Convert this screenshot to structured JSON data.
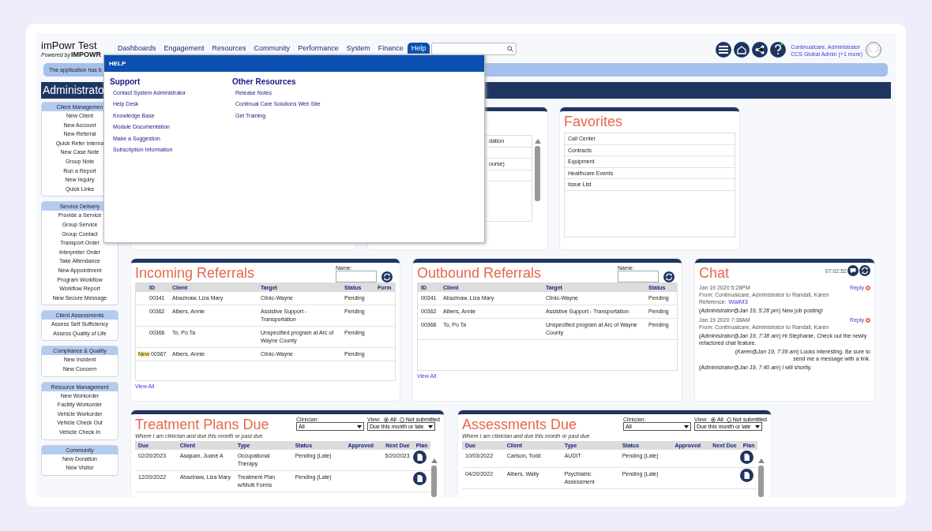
{
  "app": {
    "title": "imPowr Test",
    "powered_by": "Powered by",
    "brand": "IMPOWR"
  },
  "nav": [
    {
      "label": "Dashboards",
      "selected": false
    },
    {
      "label": "Engagement",
      "selected": false
    },
    {
      "label": "Resources",
      "selected": false
    },
    {
      "label": "Community",
      "selected": false
    },
    {
      "label": "Performance",
      "selected": false
    },
    {
      "label": "System",
      "selected": false
    },
    {
      "label": "Finance",
      "selected": false
    },
    {
      "label": "Help",
      "selected": true
    }
  ],
  "user": {
    "name": "Continualcare, Administrator",
    "role": "CCS Global Admin (+1 more)"
  },
  "banner": "The application has b",
  "page_title": "Administrato",
  "help_menu": {
    "title": "HELP",
    "sections": [
      {
        "heading": "Support",
        "links": [
          "Contact System Administrator",
          "Help Desk",
          "Knowledge Base",
          "Module Documentation",
          "Make a Suggestion",
          "Subscription Information"
        ]
      },
      {
        "heading": "Other Resources",
        "links": [
          "Release Notes",
          "Continual Care Solutions Web Site",
          "Get Training"
        ]
      }
    ]
  },
  "sidebar": [
    {
      "title": "Client Managemen",
      "items": [
        "New Client",
        "New Account",
        "New Referral",
        "Quick Refer Interna",
        "New Case Note",
        "Group Note",
        "Run a Report",
        "New Inquiry",
        "Quick Links"
      ]
    },
    {
      "title": "Service Delivery",
      "items": [
        "Provide a Service",
        "Group Service",
        "Group Contact",
        "Transport Order",
        "Interpreter Order",
        "Take Attendance",
        "New Appointment",
        "Program Workflow",
        "Workflow Report",
        "New Secure Message"
      ]
    },
    {
      "title": "Client Assessments",
      "items": [
        "Assess Self Sufficiency",
        "Assess Quality of Life"
      ]
    },
    {
      "title": "Compliance & Quality",
      "items": [
        "New Incident",
        "New Concern"
      ]
    },
    {
      "title": "Resource Management",
      "items": [
        "New Workorder",
        "Facility Workorder",
        "Vehicle Workorder",
        "Vehicle Check Out",
        "Vehicle Check In"
      ]
    },
    {
      "title": "Community",
      "items": [
        "New Donation",
        "New Visitor"
      ]
    }
  ],
  "covered_list": {
    "rows": [
      "dation",
      "ourse)"
    ]
  },
  "favorites": {
    "title": "Favorites",
    "items": [
      "Call Center",
      "Contracts",
      "Equipment",
      "Healthcare Events",
      "Issue List"
    ]
  },
  "incoming": {
    "title": "Incoming Referrals",
    "name_label": "Name:",
    "columns": [
      "ID",
      "Client",
      "Target",
      "Status",
      "Form"
    ],
    "rows": [
      {
        "id": "00341",
        "client": "Abazinaw, Liza Mary",
        "target": "Clinic-Wayne",
        "status": "Pending"
      },
      {
        "id": "00362",
        "client": "Albers, Annie",
        "target": "Assistive Support - Transportation",
        "status": "Pending"
      },
      {
        "id": "00366",
        "client": "To, Po Ta",
        "target": "Unspecified program at Arc of Wayne County",
        "status": "Pending"
      },
      {
        "id": "00367",
        "client": "Albers, Annie",
        "target": "Clinic-Wayne",
        "status": "Pending",
        "badge": "New"
      }
    ],
    "view_all": "View All"
  },
  "outbound": {
    "title": "Outbound Referrals",
    "name_label": "Name:",
    "columns": [
      "ID",
      "Client",
      "Target",
      "Status"
    ],
    "rows": [
      {
        "id": "00341",
        "client": "Abazinaw, Liza Mary",
        "target": "Clinic-Wayne",
        "status": "Pending"
      },
      {
        "id": "00362",
        "client": "Albers, Annie",
        "target": "Assistive Support - Transportation",
        "status": "Pending"
      },
      {
        "id": "00366",
        "client": "To, Po Ta",
        "target": "Unspecified program at Arc of Wayne County",
        "status": "Pending"
      }
    ],
    "view_all": "View All"
  },
  "chat": {
    "title": "Chat",
    "time": "07:02:52",
    "messages": [
      {
        "date": "Jan 19 2020 5:28PM",
        "from": "From: Continualcare, Administrator to Randall, Karen",
        "reply": "Reply",
        "reference_label": "Reference:",
        "reference": "WalM3",
        "lines": [
          {
            "kind": "outgoing",
            "text": "(*Administrator@Jan 19, 5:28 pm*) New job posting!"
          }
        ]
      },
      {
        "date": "Jan 19 2020 7:38AM",
        "from": "From: Continualcare, Administrator to Randall, Karen",
        "reply": "Reply",
        "lines": [
          {
            "kind": "outgoing",
            "text": "(*Administrator@Jan 19, 7:38 am*) Hi Stephanie, Check out the newly refactored chat feature."
          },
          {
            "kind": "incoming",
            "text": "(*Karen@Jan 19, 7:39 am*) Looks interesting. Be sure to send me a message with a link."
          },
          {
            "kind": "outgoing",
            "text": "(*Administrator@Jan 19, 7:40 am*) I will shortly."
          }
        ]
      }
    ]
  },
  "due_panels": [
    {
      "title": "Treatment Plans Due",
      "subtitle": "Where I am clinician and due this month or past due",
      "clinician_label": "Clinician:",
      "clinician": "All",
      "view_label": "View:",
      "view_options": [
        {
          "label": "All",
          "selected": true
        },
        {
          "label": "Not submitted",
          "selected": false
        }
      ],
      "period": "Due this month or late",
      "columns": [
        "Due",
        "Client",
        "Type",
        "Status",
        "Approved",
        "Next Due",
        "Plan"
      ],
      "rows": [
        {
          "due": "02/20/2023",
          "client": "Aaajuan, Juané A",
          "type": "Occupational Therapy",
          "status": "Pending (Late)",
          "next_due": "5/20/2023"
        },
        {
          "due": "12/20/2022",
          "client": "Abazinaw, Liza Mary",
          "type": "Treatment Plan w/Multi Forms",
          "status": "Pending (Late)"
        }
      ]
    },
    {
      "title": "Assessments Due",
      "subtitle": "Where I am clinician and due this month or past due",
      "clinician_label": "Clinician:",
      "clinician": "All",
      "view_label": "View:",
      "view_options": [
        {
          "label": "All",
          "selected": true
        },
        {
          "label": "Not submitted",
          "selected": false
        }
      ],
      "period": "Due this month or late",
      "columns": [
        "Due",
        "Client",
        "Type",
        "Status",
        "Approved",
        "Next Due",
        "Plan"
      ],
      "rows": [
        {
          "due": "10/03/2022",
          "client": "Carlson, Todd",
          "type": "AUDIT",
          "status": "Pending (Late)"
        },
        {
          "due": "04/20/2022",
          "client": "Albers, Wally",
          "type": "Psychiatric Assessment",
          "status": "Pending (Late)"
        }
      ]
    }
  ]
}
